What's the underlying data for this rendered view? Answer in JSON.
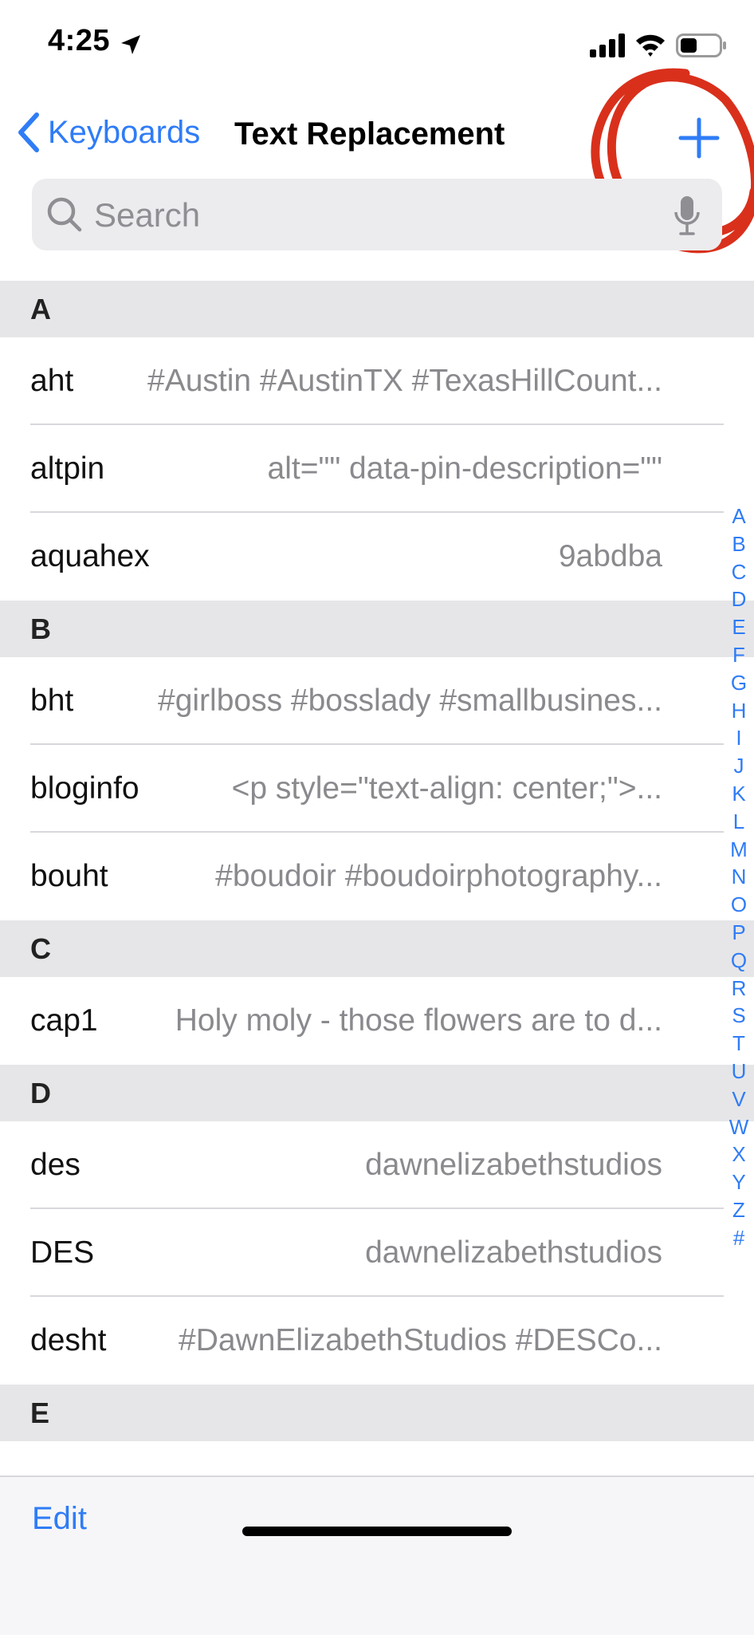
{
  "status_bar": {
    "time": "4:25"
  },
  "nav": {
    "back_label": "Keyboards",
    "title": "Text Replacement"
  },
  "search": {
    "placeholder": "Search"
  },
  "sections": [
    {
      "letter": "A",
      "rows": [
        {
          "shortcut": "aht",
          "phrase": "#Austin #AustinTX #TexasHillCount..."
        },
        {
          "shortcut": "altpin",
          "phrase": "alt=\"\" data-pin-description=\"\""
        },
        {
          "shortcut": "aquahex",
          "phrase": "9abdba"
        }
      ]
    },
    {
      "letter": "B",
      "rows": [
        {
          "shortcut": "bht",
          "phrase": "#girlboss #bosslady #smallbusines..."
        },
        {
          "shortcut": "bloginfo",
          "phrase": "<p style=\"text-align: center;\">..."
        },
        {
          "shortcut": "bouht",
          "phrase": "#boudoir #boudoirphotography..."
        }
      ]
    },
    {
      "letter": "C",
      "rows": [
        {
          "shortcut": "cap1",
          "phrase": "Holy moly - those flowers are to d..."
        }
      ]
    },
    {
      "letter": "D",
      "rows": [
        {
          "shortcut": "des",
          "phrase": "dawnelizabethstudios"
        },
        {
          "shortcut": "DES",
          "phrase": "dawnelizabethstudios"
        },
        {
          "shortcut": "desht",
          "phrase": "#DawnElizabethStudios #DESCo..."
        }
      ]
    },
    {
      "letter": "E",
      "rows": []
    }
  ],
  "index_letters": [
    "A",
    "B",
    "C",
    "D",
    "E",
    "F",
    "G",
    "H",
    "I",
    "J",
    "K",
    "L",
    "M",
    "N",
    "O",
    "P",
    "Q",
    "R",
    "S",
    "T",
    "U",
    "V",
    "W",
    "X",
    "Y",
    "Z",
    "#"
  ],
  "toolbar": {
    "edit_label": "Edit"
  },
  "colors": {
    "accent": "#2f7cf6",
    "annotation": "#d9301c",
    "section_bg": "#e6e6e8"
  }
}
